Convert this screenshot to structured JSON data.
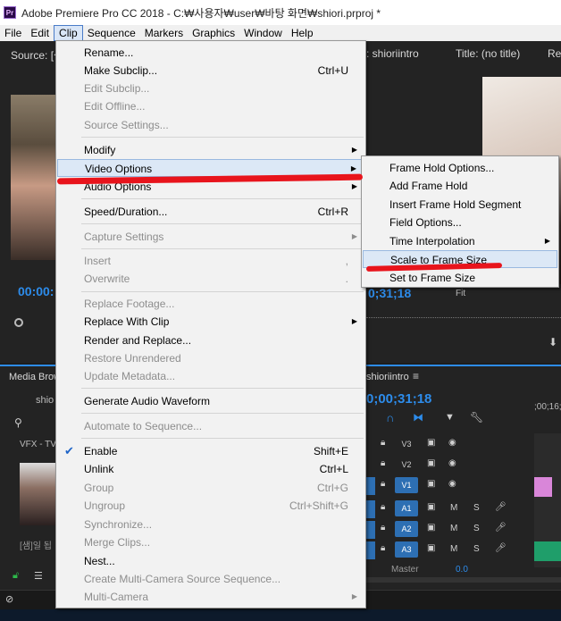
{
  "window": {
    "title": "Adobe Premiere Pro CC 2018 - C:₩사용자₩user₩바탕 화면₩shiori.prproj *",
    "logo": "Pr"
  },
  "menubar": [
    {
      "label": "File"
    },
    {
      "label": "Edit"
    },
    {
      "label": "Clip"
    },
    {
      "label": "Sequence"
    },
    {
      "label": "Markers"
    },
    {
      "label": "Graphics"
    },
    {
      "label": "Window"
    },
    {
      "label": "Help"
    }
  ],
  "panels": {
    "source_tab": "Source: [샘",
    "program_tab": "m: shioriintro",
    "title_tab": "Title: (no title)",
    "ref_tab": "Re",
    "timecode_left": "00:00:",
    "timecode_right": "0;31;18",
    "fit": "Fit",
    "media_browser": "Media Brow",
    "project_name": "shio",
    "vfx": "VFX - TV",
    "clip_label": "[샘]일 됩",
    "sequence_tab": "shioriintro",
    "sequence_time": "0;00;31;18",
    "ruler_time": ";00;16;",
    "tracks": [
      {
        "name": "V3",
        "lock": "lock-icon",
        "toggle": "film-icon",
        "eye": "eye-icon"
      },
      {
        "name": "V2",
        "lock": "lock-icon",
        "toggle": "film-icon",
        "eye": "eye-icon"
      },
      {
        "name": "V1",
        "lock": "lock-icon",
        "toggle": "film-icon",
        "eye": "eye-icon"
      },
      {
        "name": "A1",
        "lock": "lock-icon",
        "m": "M",
        "s": "S"
      },
      {
        "name": "A2",
        "lock": "lock-icon",
        "m": "M",
        "s": "S"
      },
      {
        "name": "A3",
        "lock": "lock-icon",
        "m": "M",
        "s": "S"
      }
    ],
    "master": "Master",
    "master_value": "0.0"
  },
  "clip_menu": {
    "items": [
      {
        "label": "Rename...",
        "shortcut": "",
        "disabled": false
      },
      {
        "label": "Make Subclip...",
        "shortcut": "Ctrl+U",
        "disabled": false
      },
      {
        "label": "Edit Subclip...",
        "shortcut": "",
        "disabled": true
      },
      {
        "label": "Edit Offline...",
        "shortcut": "",
        "disabled": true
      },
      {
        "label": "Source Settings...",
        "shortcut": "",
        "disabled": true
      },
      {
        "label": "Modify",
        "shortcut": "",
        "disabled": false,
        "submenu": true
      },
      {
        "label": "Video Options",
        "shortcut": "",
        "disabled": false,
        "submenu": true,
        "highlighted": true
      },
      {
        "label": "Audio Options",
        "shortcut": "",
        "disabled": false,
        "submenu": true
      },
      {
        "label": "Speed/Duration...",
        "shortcut": "Ctrl+R",
        "disabled": false
      },
      {
        "label": "Capture Settings",
        "shortcut": "",
        "disabled": true,
        "submenu": true
      },
      {
        "label": "Insert",
        "shortcut": ",",
        "disabled": true
      },
      {
        "label": "Overwrite",
        "shortcut": ".",
        "disabled": true
      },
      {
        "label": "Replace Footage...",
        "shortcut": "",
        "disabled": true
      },
      {
        "label": "Replace With Clip",
        "shortcut": "",
        "disabled": false,
        "submenu": true
      },
      {
        "label": "Render and Replace...",
        "shortcut": "",
        "disabled": false
      },
      {
        "label": "Restore Unrendered",
        "shortcut": "",
        "disabled": true
      },
      {
        "label": "Update Metadata...",
        "shortcut": "",
        "disabled": true
      },
      {
        "label": "Generate Audio Waveform",
        "shortcut": "",
        "disabled": false
      },
      {
        "label": "Automate to Sequence...",
        "shortcut": "",
        "disabled": true
      },
      {
        "label": "Enable",
        "shortcut": "Shift+E",
        "disabled": false,
        "checked": true
      },
      {
        "label": "Unlink",
        "shortcut": "Ctrl+L",
        "disabled": false
      },
      {
        "label": "Group",
        "shortcut": "Ctrl+G",
        "disabled": true
      },
      {
        "label": "Ungroup",
        "shortcut": "Ctrl+Shift+G",
        "disabled": true
      },
      {
        "label": "Synchronize...",
        "shortcut": "",
        "disabled": true
      },
      {
        "label": "Merge Clips...",
        "shortcut": "",
        "disabled": true
      },
      {
        "label": "Nest...",
        "shortcut": "",
        "disabled": false
      },
      {
        "label": "Create Multi-Camera Source Sequence...",
        "shortcut": "",
        "disabled": true
      },
      {
        "label": "Multi-Camera",
        "shortcut": "",
        "disabled": true,
        "submenu": true
      }
    ]
  },
  "video_options_submenu": {
    "items": [
      {
        "label": "Frame Hold Options..."
      },
      {
        "label": "Add Frame Hold"
      },
      {
        "label": "Insert Frame Hold Segment"
      },
      {
        "label": "Field Options..."
      },
      {
        "label": "Time Interpolation",
        "submenu": true
      },
      {
        "label": "Scale to Frame Size",
        "highlighted": true
      },
      {
        "label": "Set to Frame Size"
      }
    ]
  },
  "colors": {
    "accent_blue": "#2d8ceb",
    "annotation_red": "#e8141c",
    "menu_bg": "#f2f2f2",
    "highlight": "#dce8f6",
    "clip_pink": "#d986d9",
    "audio_green": "#1f9e6a"
  }
}
